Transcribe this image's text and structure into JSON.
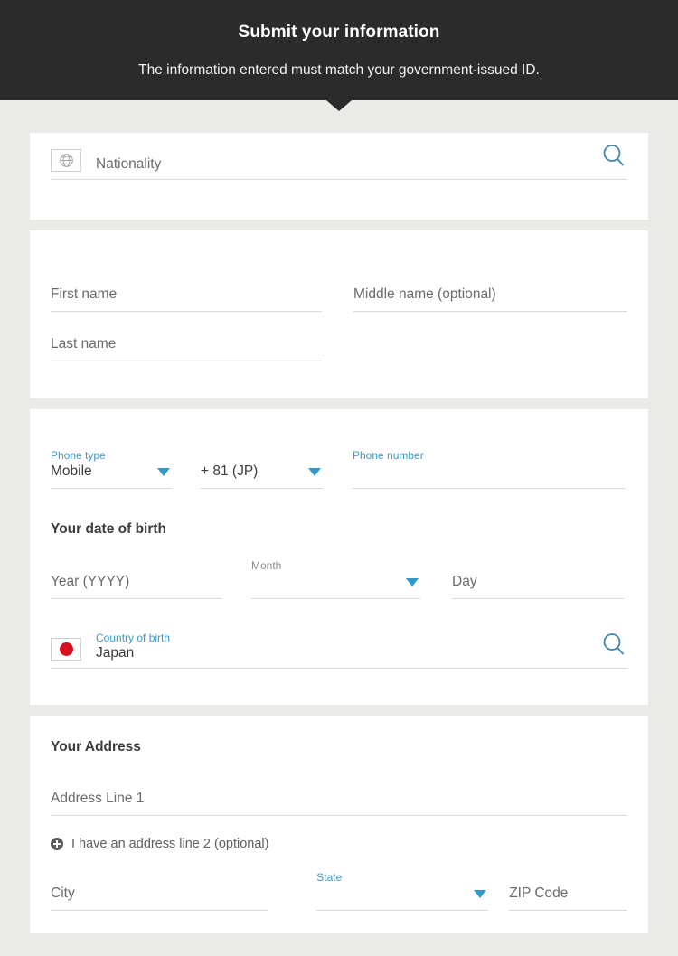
{
  "header": {
    "title": "Submit your information",
    "subtitle": "The information entered must match your government-issued ID."
  },
  "nationality": {
    "flag_icon": "globe-icon",
    "placeholder": "Nationality",
    "search_icon": "search-icon"
  },
  "names": {
    "first_name_placeholder": "First name",
    "middle_name_placeholder": "Middle name (optional)",
    "last_name_placeholder": "Last name"
  },
  "phone": {
    "type_label": "Phone type",
    "type_value": "Mobile",
    "country_code_value": "+ 81 (JP)",
    "number_label": "Phone number",
    "caret_icon": "chevron-down-icon"
  },
  "dob": {
    "heading": "Your date of birth",
    "year_placeholder": "Year (YYYY)",
    "month_label": "Month",
    "day_placeholder": "Day"
  },
  "country_of_birth": {
    "label": "Country of birth",
    "value": "Japan",
    "flag_icon": "flag-japan-icon",
    "search_icon": "search-icon"
  },
  "address": {
    "heading": "Your Address",
    "line1_placeholder": "Address Line 1",
    "add_line2_label": "I have an address line 2 (optional)",
    "add_line2_icon": "plus-circle-icon",
    "city_placeholder": "City",
    "state_label": "State",
    "zip_placeholder": "ZIP Code"
  },
  "colors": {
    "header_bg": "#2b2b2b",
    "page_bg": "#eaeae6",
    "card_bg": "#ffffff",
    "accent_blue": "#3d9ac4",
    "caret_blue": "#2f9bc9",
    "flag_red": "#d6101e",
    "text_dark": "#3c3c3c",
    "placeholder_grey": "#6b6b6b",
    "underline_grey": "#d8d8d4"
  }
}
